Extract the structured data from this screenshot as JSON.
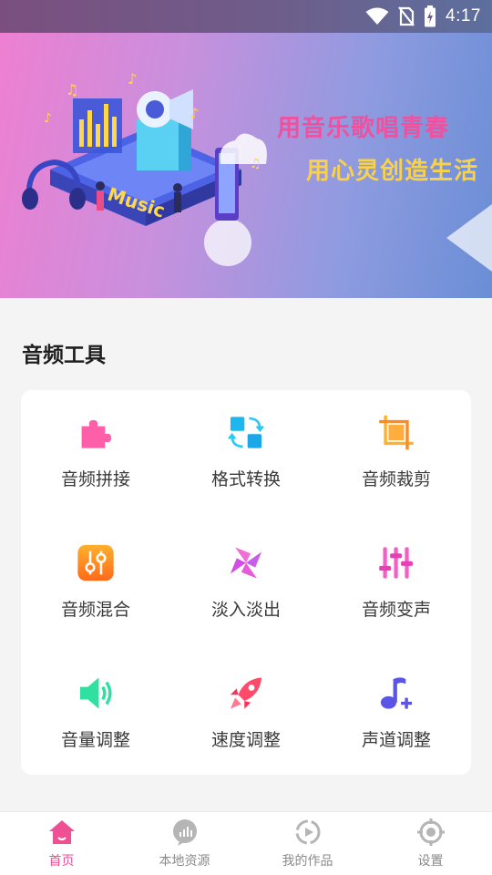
{
  "status_bar": {
    "time": "4:17",
    "icons": [
      "wifi-icon",
      "no-sim-icon",
      "battery-charging-icon"
    ]
  },
  "banner": {
    "slogan_line1": "用音乐歌唱青春",
    "slogan_line2": "用心灵创造生活",
    "illustration_text": "Music",
    "colors": {
      "slogan_pink": "#f0519e",
      "slogan_yellow": "#f9d24a"
    }
  },
  "section": {
    "title": "音频工具"
  },
  "tools": [
    {
      "label": "音频拼接",
      "icon": "puzzle-icon",
      "color": "#ff5fa8"
    },
    {
      "label": "格式转换",
      "icon": "convert-icon",
      "color": "#1fb6f0"
    },
    {
      "label": "音频裁剪",
      "icon": "crop-icon",
      "color": "#ff9f1c"
    },
    {
      "label": "音频混合",
      "icon": "mixer-icon",
      "color": "#ff8a1f"
    },
    {
      "label": "淡入淡出",
      "icon": "pinwheel-icon",
      "color": "#e65bd8"
    },
    {
      "label": "音频变声",
      "icon": "equalizer-icon",
      "color": "#f45fc7"
    },
    {
      "label": "音量调整",
      "icon": "speaker-icon",
      "color": "#2fe0a0"
    },
    {
      "label": "速度调整",
      "icon": "rocket-icon",
      "color": "#ff4b6b"
    },
    {
      "label": "声道调整",
      "icon": "music-note-add-icon",
      "color": "#5b55e6"
    }
  ],
  "bottom_nav": {
    "active_color": "#ef4f93",
    "items": [
      {
        "label": "首页",
        "icon": "home-icon",
        "active": true
      },
      {
        "label": "本地资源",
        "icon": "local-resource-icon",
        "active": false
      },
      {
        "label": "我的作品",
        "icon": "my-works-icon",
        "active": false
      },
      {
        "label": "设置",
        "icon": "settings-icon",
        "active": false
      }
    ]
  }
}
